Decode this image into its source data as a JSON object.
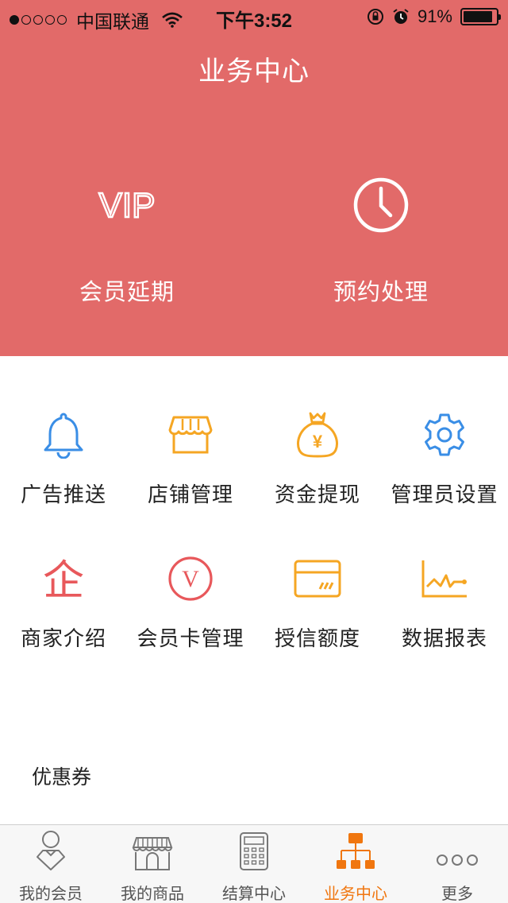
{
  "status_bar": {
    "signal_dots": 5,
    "signal_filled": 1,
    "carrier": "中国联通",
    "time": "下午3:52",
    "battery_text": "91%",
    "battery_level": 0.91
  },
  "header": {
    "title": "业务中心"
  },
  "hero": [
    {
      "icon": "vip-icon",
      "icon_text": "VIP",
      "label": "会员延期"
    },
    {
      "icon": "clock-icon",
      "label": "预约处理"
    }
  ],
  "grid": [
    {
      "icon": "bell-icon",
      "color": "#3a8ee6",
      "label": "广告推送"
    },
    {
      "icon": "storefront-icon",
      "color": "#f5a623",
      "label": "店铺管理"
    },
    {
      "icon": "money-bag-icon",
      "color": "#f5a623",
      "label": "资金提现",
      "glyph": "¥"
    },
    {
      "icon": "gear-icon",
      "color": "#3a8ee6",
      "label": "管理员设置"
    },
    {
      "icon": "enterprise-icon",
      "color": "#e8585b",
      "label": "商家介绍",
      "glyph": "企"
    },
    {
      "icon": "v-circle-icon",
      "color": "#e8585b",
      "label": "会员卡管理",
      "glyph": "V"
    },
    {
      "icon": "credit-card-icon",
      "color": "#f5a623",
      "label": "授信额度"
    },
    {
      "icon": "line-chart-icon",
      "color": "#f5a623",
      "label": "数据报表"
    }
  ],
  "coupon": {
    "label": "优惠券"
  },
  "tabbar": {
    "active_color": "#f0760f",
    "tabs": [
      {
        "icon": "member-icon",
        "label": "我的会员",
        "active": false
      },
      {
        "icon": "shop-icon",
        "label": "我的商品",
        "active": false
      },
      {
        "icon": "calculator-icon",
        "label": "结算中心",
        "active": false
      },
      {
        "icon": "org-chart-icon",
        "label": "业务中心",
        "active": true
      },
      {
        "icon": "more-dots-icon",
        "label": "更多",
        "active": false
      }
    ]
  },
  "colors": {
    "hero_bg": "#e26a69"
  }
}
